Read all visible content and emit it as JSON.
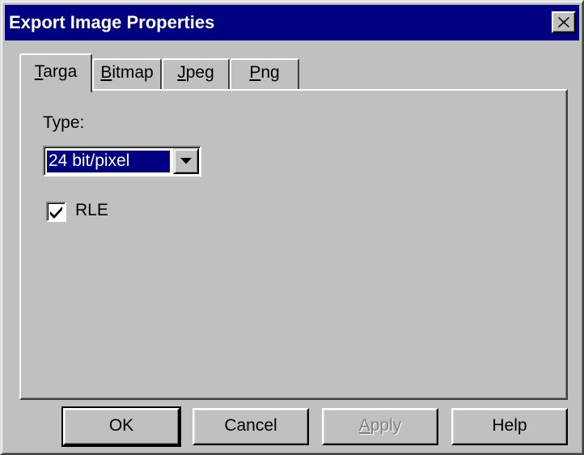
{
  "window": {
    "title": "Export Image Properties"
  },
  "tabs": [
    {
      "label": "Targa",
      "mnemonic": "T",
      "rest": "arga",
      "active": true
    },
    {
      "label": "Bitmap",
      "mnemonic": "B",
      "rest": "itmap",
      "active": false
    },
    {
      "label": "Jpeg",
      "mnemonic": "J",
      "rest": "peg",
      "active": false
    },
    {
      "label": "Png",
      "mnemonic": "P",
      "rest": "ng",
      "active": false
    }
  ],
  "targa": {
    "type_label": "Type:",
    "type_value": "24 bit/pixel",
    "rle_label": "RLE",
    "rle_checked": true
  },
  "buttons": {
    "ok": "OK",
    "cancel": "Cancel",
    "apply": {
      "label": "Apply",
      "mnemonic": "A",
      "rest": "pply",
      "enabled": false
    },
    "help": "Help"
  },
  "colors": {
    "titlebar": "#000080",
    "face": "#c0c0c0",
    "selection": "#000080"
  },
  "icons": {
    "close": "close-icon",
    "dropdown": "dropdown-arrow-icon",
    "check": "checkmark-icon"
  }
}
